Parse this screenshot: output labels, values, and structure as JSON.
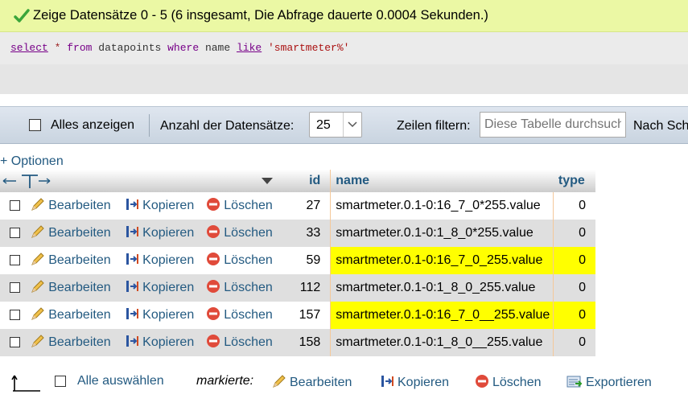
{
  "success": {
    "message": "Zeige Datensätze 0 - 5 (6 insgesamt, Die Abfrage dauerte 0.0004 Sekunden.)",
    "color": "#ebf8a4"
  },
  "sql": {
    "select": "select",
    "star": "*",
    "from": "from",
    "table": "datapoints",
    "where": "where",
    "column": "name",
    "like": "like",
    "value": "'smartmeter%'"
  },
  "nav": {
    "show_all_label": "Alles anzeigen",
    "rows_label": "Anzahl der Datensätze:",
    "rows_value": "25",
    "filter_label": "Zeilen filtern:",
    "filter_placeholder": "Diese Tabelle durchsuchen",
    "sort_label": "Nach Sch"
  },
  "options_link": "+ Optionen",
  "table": {
    "columns": {
      "id": "id",
      "name": "name",
      "type": "type"
    },
    "actions": {
      "edit": "Bearbeiten",
      "copy": "Kopieren",
      "delete": "Löschen"
    },
    "rows": [
      {
        "id": "27",
        "name": "smartmeter.0.1-0:16_7_0*255.value",
        "type": "0",
        "highlight": false
      },
      {
        "id": "33",
        "name": "smartmeter.0.1-0:1_8_0*255.value",
        "type": "0",
        "highlight": false
      },
      {
        "id": "59",
        "name": "smartmeter.0.1-0:16_7_0_255.value",
        "type": "0",
        "highlight": true
      },
      {
        "id": "112",
        "name": "smartmeter.0.1-0:1_8_0_255.value",
        "type": "0",
        "highlight": false
      },
      {
        "id": "157",
        "name": "smartmeter.0.1-0:16_7_0__255.value",
        "type": "0",
        "highlight": true
      },
      {
        "id": "158",
        "name": "smartmeter.0.1-0:1_8_0__255.value",
        "type": "0",
        "highlight": false
      }
    ]
  },
  "bottom": {
    "select_all_label": "Alle auswählen",
    "marked_label": "markierte:",
    "edit": "Bearbeiten",
    "copy": "Kopieren",
    "delete": "Löschen",
    "export": "Exportieren"
  },
  "colors": {
    "link": "#235a81",
    "highlight": "#ffff00",
    "nav_bg": "#d4dde8"
  }
}
